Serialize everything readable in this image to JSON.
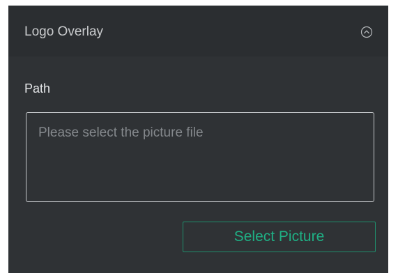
{
  "panel": {
    "title": "Logo Overlay",
    "collapse_icon": "chevron-up-circle-icon"
  },
  "path": {
    "label": "Path",
    "placeholder": "Please select the picture file",
    "value": ""
  },
  "actions": {
    "select_label": "Select Picture"
  },
  "colors": {
    "panel_bg": "#2f3235",
    "header_bg": "#2b2e31",
    "accent": "#1fb085"
  }
}
